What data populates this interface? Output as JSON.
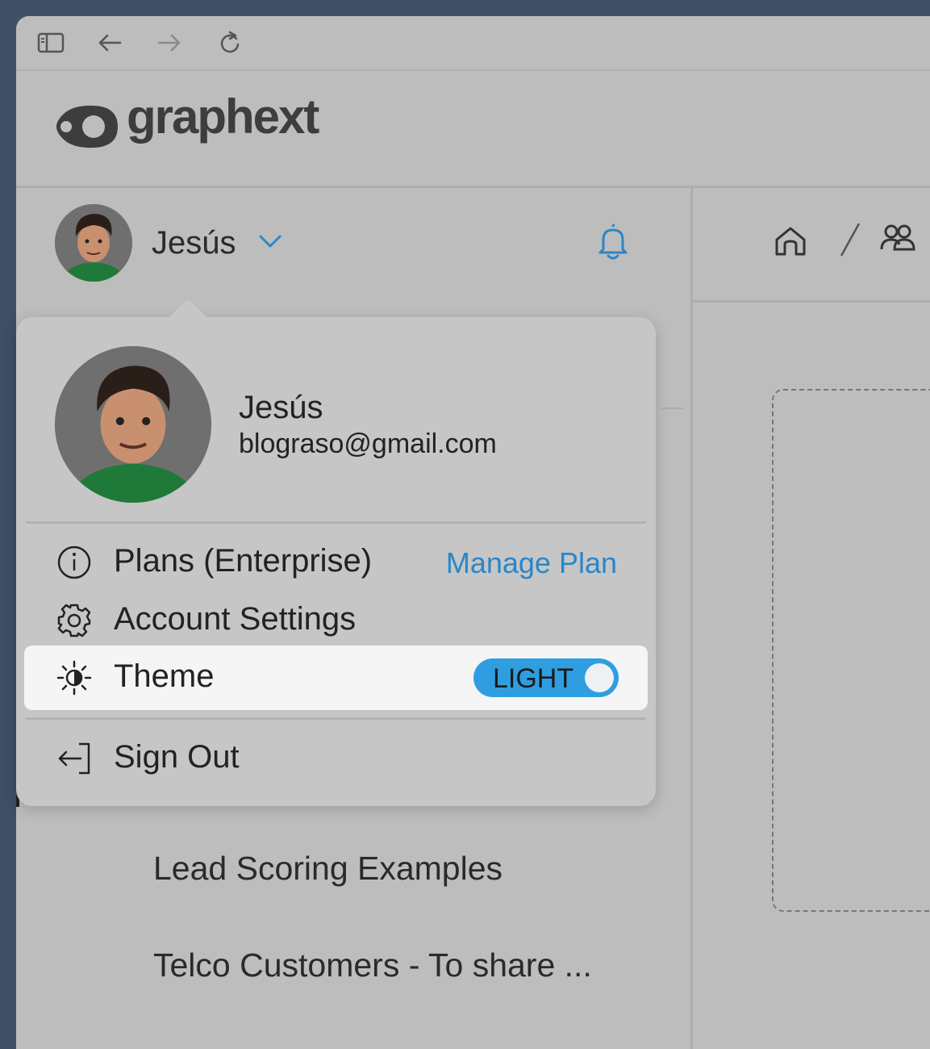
{
  "app": {
    "logo_text": "graphext"
  },
  "toolbar": {
    "icons": [
      "sidebar-toggle-icon",
      "back-arrow-icon",
      "forward-arrow-icon",
      "reload-icon"
    ]
  },
  "user": {
    "name": "Jesús",
    "email": "blograso@gmail.com"
  },
  "menu": {
    "plans_label": "Plans (Enterprise)",
    "manage_plan_label": "Manage Plan",
    "account_settings_label": "Account Settings",
    "theme_label": "Theme",
    "theme_value": "LIGHT",
    "sign_out_label": "Sign Out"
  },
  "sidebar": {
    "items": [
      {
        "label": "Lead Scoring Examples"
      },
      {
        "label": "Telco Customers - To share ..."
      }
    ]
  },
  "breadcrumb": {
    "separator": "/"
  },
  "colors": {
    "accent": "#2a86c9",
    "toggle": "#2f9ee0",
    "background": "#bdbdbd"
  }
}
